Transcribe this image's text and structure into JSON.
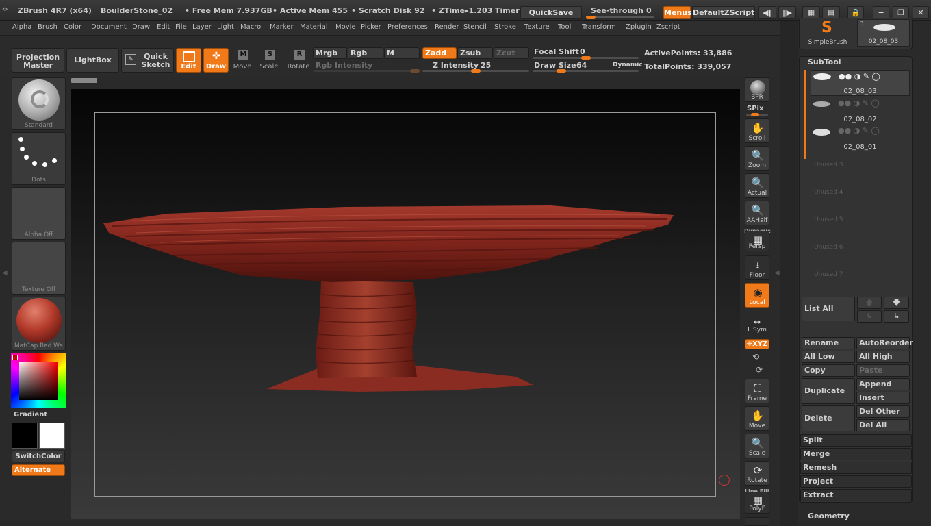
{
  "title": {
    "app": "ZBrush 4R7 (x64)",
    "doc": "BoulderStone_02",
    "free_mem": "• Free Mem 7.937GB",
    "active_mem": "• Active Mem 455",
    "scratch": "• Scratch Disk 92",
    "ztime": "• ZTime▸1.203",
    "timer": "Timer",
    "quicksave": "QuickSave",
    "seethrough": "See-through",
    "seethrough_value": "0",
    "menus": "Menus",
    "script": "DefaultZScript"
  },
  "menus": [
    "Alpha",
    "Brush",
    "Color",
    "Document",
    "Draw",
    "Edit",
    "File",
    "Layer",
    "Light",
    "Macro",
    "Marker",
    "Material",
    "Movie",
    "Picker",
    "Preferences",
    "Render",
    "Stencil",
    "Stroke",
    "Texture",
    "Tool",
    "Transform",
    "Zplugin",
    "Zscript"
  ],
  "shelf": {
    "projection_master": "Projection Master",
    "lightbox": "LightBox",
    "quick_sketch": "Quick Sketch",
    "edit": "Edit",
    "draw": "Draw",
    "move": "Move",
    "scale": "Scale",
    "rotate": "Rotate",
    "mrgb": "Mrgb",
    "rgb": "Rgb",
    "m": "M",
    "rgb_intensity": "Rgb Intensity",
    "zadd": "Zadd",
    "zsub": "Zsub",
    "zcut": "Zcut",
    "z_intensity_label": "Z Intensity",
    "z_intensity": "25",
    "focal_shift_label": "Focal Shift",
    "focal_shift": "0",
    "draw_size_label": "Draw Size",
    "draw_size": "64",
    "dynamic": "Dynamic",
    "active_points": "ActivePoints: 33,886",
    "total_points": "TotalPoints: 339,057"
  },
  "left": {
    "brush": "Standard",
    "stroke": "Dots",
    "alpha": "Alpha  Off",
    "texture": "Texture  Off",
    "material": "MatCap  Red  Wa",
    "gradient": "Gradient",
    "switch_color": "SwitchColor",
    "alternate": "Alternate"
  },
  "right_toolbar": {
    "bpr": "BPR",
    "spix": "SPix",
    "scroll": "Scroll",
    "zoom": "Zoom",
    "actual": "Actual",
    "aahalf": "AAHalf",
    "dynamic": "Dynamic",
    "persp": "Persp",
    "floor": "Floor",
    "local": "Local",
    "lsym": "L.Sym",
    "xyz": "❈XYZ",
    "frame": "Frame",
    "move": "Move",
    "scale": "Scale",
    "rotate": "Rotate",
    "line_fill": "Line Fill",
    "polyf": "PolyF"
  },
  "right_panel": {
    "simple_brush": "SimpleBrush",
    "tool_thumb": "02_08_03",
    "tool_count": "3",
    "subtool_title": "SubTool",
    "subtools": [
      "02_08_03",
      "02_08_02",
      "02_08_01"
    ],
    "unused": [
      "Unused 3",
      "Unused 4",
      "Unused 5",
      "Unused 6",
      "Unused 7"
    ],
    "list_all": "List All",
    "rename": "Rename",
    "auto_reorder": "AutoReorder",
    "all_low": "All Low",
    "all_high": "All High",
    "copy": "Copy",
    "paste": "Paste",
    "append": "Append",
    "duplicate": "Duplicate",
    "insert": "Insert",
    "delete": "Delete",
    "del_other": "Del Other",
    "del_all": "Del All",
    "split": "Split",
    "merge": "Merge",
    "remesh": "Remesh",
    "project": "Project",
    "extract": "Extract",
    "geometry": "Geometry"
  },
  "colors": {
    "accent": "#f07a1a",
    "stone": "#8c2a22"
  }
}
